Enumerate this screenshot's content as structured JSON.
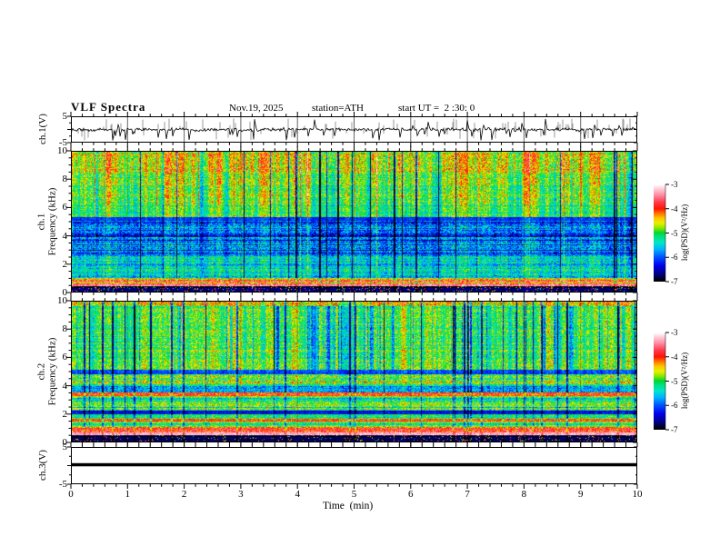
{
  "header": {
    "title": "VLF Spectra",
    "date": "Nov.19, 2025",
    "station": "station=ATH",
    "start_ut": "start UT =  2 :30: 0"
  },
  "panels": {
    "wave1": {
      "ylabel": "ch.1(V)",
      "ytick_labels": [
        "5",
        "-5"
      ],
      "ylim": [
        -5,
        5
      ]
    },
    "spec1": {
      "channel": "ch.1",
      "ylabel": "Frequency (kHz)",
      "ytick_labels": [
        "10",
        "8",
        "6",
        "4",
        "2",
        "0"
      ],
      "ylim": [
        0,
        10
      ]
    },
    "spec2": {
      "channel": "ch.2",
      "ylabel": "Frequency (kHz)",
      "ytick_labels": [
        "10",
        "8",
        "6",
        "4",
        "2",
        "0"
      ],
      "ylim": [
        0,
        10
      ]
    },
    "wave3": {
      "ylabel": "ch.3(V)",
      "ytick_labels": [
        "5",
        "-5"
      ],
      "ylim": [
        -5,
        5
      ]
    }
  },
  "xaxis": {
    "label": "Time  (min)",
    "tick_labels": [
      "0",
      "1",
      "2",
      "3",
      "4",
      "5",
      "6",
      "7",
      "8",
      "9",
      "10"
    ],
    "range": [
      0,
      10
    ],
    "minor_step_min": 0.2
  },
  "colorbars": [
    {
      "label": "log(PSD)(V²/Hz)",
      "tick_labels": [
        "-3",
        "-4",
        "-5",
        "-6",
        "-7"
      ],
      "range": [
        -7,
        -3
      ]
    },
    {
      "label": "log(PSD)(V²/Hz)",
      "tick_labels": [
        "-3",
        "-4",
        "-5",
        "-6",
        "-7"
      ],
      "range": [
        -7,
        -3
      ]
    }
  ],
  "colormap": {
    "stops": [
      [
        0.0,
        "#000000"
      ],
      [
        0.07,
        "#000080"
      ],
      [
        0.16,
        "#0000ee"
      ],
      [
        0.25,
        "#0055ff"
      ],
      [
        0.33,
        "#00b4ff"
      ],
      [
        0.4,
        "#00e8c8"
      ],
      [
        0.47,
        "#00e070"
      ],
      [
        0.5,
        "#00d830"
      ],
      [
        0.55,
        "#8ce800"
      ],
      [
        0.6,
        "#e8f000"
      ],
      [
        0.65,
        "#ffc800"
      ],
      [
        0.7,
        "#ff7800"
      ],
      [
        0.75,
        "#ff1400"
      ],
      [
        0.82,
        "#ff3c50"
      ],
      [
        0.9,
        "#ff96aa"
      ],
      [
        0.96,
        "#ffd2dc"
      ],
      [
        1.0,
        "#ffffff"
      ]
    ]
  },
  "chart_data": [
    {
      "id": "ch1_waveform",
      "type": "line",
      "title": "ch.1 raw amplitude vs time",
      "x_range_min": [
        0,
        10
      ],
      "ylim": [
        -5,
        5
      ],
      "baseline_v": 0,
      "noise_std_v": 0.45,
      "spike_count": 55,
      "spike_amp_range_v": [
        1.2,
        4.5
      ],
      "spike_sign_bias_down": 0.6,
      "gray_envelope_count": 90,
      "gray_envelope_amp_v": [
        1.0,
        4.5
      ],
      "grid": "vertical lines each minute"
    },
    {
      "id": "ch1_spectrogram",
      "type": "heatmap",
      "title": "ch.1 VLF spectrogram",
      "x_range_min": [
        0,
        10
      ],
      "y_range": [
        0,
        10
      ],
      "ylabel": "Frequency (kHz)",
      "z_label": "log(PSD)(V²/Hz)",
      "z_range": [
        -7,
        -3
      ],
      "bands": [
        {
          "f": [
            0,
            0.42
          ],
          "level": -6.85,
          "noise": 0.2,
          "vstreak": 0.1,
          "rowvar": 0.3,
          "speckle": 0.1
        },
        {
          "f": [
            0.42,
            0.6
          ],
          "level": -3.5,
          "noise": 0.35,
          "vstreak": 0.1,
          "rowvar": 0.3
        },
        {
          "f": [
            0.6,
            0.95
          ],
          "level": -4.1,
          "noise": 0.5,
          "vstreak": 0.2,
          "rowvar": 0.5
        },
        {
          "f": [
            0.95,
            1.7
          ],
          "level": -5.25,
          "noise": 0.5,
          "vstreak": 0.45,
          "rowvar": 0.45
        },
        {
          "f": [
            1.7,
            2.65
          ],
          "level": -5.6,
          "noise": 0.5,
          "vstreak": 0.5,
          "rowvar": 0.4
        },
        {
          "f": [
            2.65,
            5.05
          ],
          "level": -6.0,
          "noise": 0.55,
          "vstreak": 0.55,
          "rowvar": 0.5
        },
        {
          "f": [
            5.05,
            5.35
          ],
          "level": -6.2,
          "noise": 0.25,
          "vstreak": 0.35,
          "rowvar": 0.1
        },
        {
          "f": [
            5.35,
            6.2
          ],
          "level": -5.1,
          "noise": 0.4,
          "vstreak": 0.9,
          "rowvar": 0.2
        },
        {
          "f": [
            6.2,
            8.4
          ],
          "level": -4.85,
          "noise": 0.45,
          "vstreak": 1.1,
          "rowvar": 0.2,
          "red_streaks": true
        },
        {
          "f": [
            8.4,
            10.01
          ],
          "level": -4.55,
          "noise": 0.5,
          "vstreak": 1.1,
          "rowvar": 0.25,
          "red_streaks": true
        }
      ],
      "column_effects": {
        "streak_scale": 0.38,
        "dark_col_prob": 0.05,
        "dark_col_delta": -1.7,
        "bright_col_prob": 0.03,
        "bright_col_delta": 0.9
      }
    },
    {
      "id": "ch2_spectrogram",
      "type": "heatmap",
      "title": "ch.2 VLF spectrogram",
      "x_range_min": [
        0,
        10
      ],
      "y_range": [
        0,
        10
      ],
      "ylabel": "Frequency (kHz)",
      "z_label": "log(PSD)(V²/Hz)",
      "z_range": [
        -7,
        -3
      ],
      "bands": [
        {
          "f": [
            0,
            0.45
          ],
          "level": -6.85,
          "noise": 0.2,
          "vstreak": 0.05,
          "rowvar": 0.3,
          "speckle": 0.08
        },
        {
          "f": [
            0.45,
            0.62
          ],
          "level": -3.35,
          "noise": 0.3,
          "vstreak": 0.1,
          "rowvar": 0.2
        },
        {
          "f": [
            0.62,
            1.05
          ],
          "level": -3.9,
          "noise": 0.45,
          "vstreak": 0.15,
          "rowvar": 0.35
        },
        {
          "f": [
            1.05,
            1.42
          ],
          "level": -5.05,
          "noise": 0.45,
          "vstreak": 0.3,
          "rowvar": 0.4
        },
        {
          "f": [
            1.42,
            1.6
          ],
          "level": -4.25,
          "noise": 0.35,
          "vstreak": 0.2,
          "rowvar": 0.2
        },
        {
          "f": [
            1.6,
            1.98
          ],
          "level": -5.0,
          "noise": 0.45,
          "vstreak": 0.35,
          "rowvar": 0.3
        },
        {
          "f": [
            1.98,
            2.2
          ],
          "level": -6.3,
          "noise": 0.3,
          "vstreak": 0.2,
          "rowvar": 0.2
        },
        {
          "f": [
            2.2,
            3.25
          ],
          "level": -5.1,
          "noise": 0.5,
          "vstreak": 0.4,
          "rowvar": 0.45
        },
        {
          "f": [
            3.25,
            3.5
          ],
          "level": -4.1,
          "noise": 0.4,
          "vstreak": 0.2,
          "rowvar": 0.2
        },
        {
          "f": [
            3.5,
            4.1
          ],
          "level": -5.55,
          "noise": 0.5,
          "vstreak": 0.4,
          "rowvar": 0.4
        },
        {
          "f": [
            4.1,
            4.8
          ],
          "level": -4.8,
          "noise": 0.55,
          "vstreak": 0.5,
          "rowvar": 0.35
        },
        {
          "f": [
            4.8,
            5.15
          ],
          "level": -6.1,
          "noise": 0.3,
          "vstreak": 0.4,
          "rowvar": 0.2
        },
        {
          "f": [
            5.15,
            9.7
          ],
          "level": -4.95,
          "noise": 0.45,
          "vstreak": 1.0,
          "rowvar": 0.2,
          "blue_patches": true
        },
        {
          "f": [
            9.7,
            10.01
          ],
          "level": -4.4,
          "noise": 0.6,
          "vstreak": 1.0,
          "rowvar": 0.2
        }
      ],
      "column_effects": {
        "streak_scale": 0.3,
        "dark_col_prob": 0.04,
        "dark_col_delta": -1.5,
        "bright_col_prob": 0.0,
        "bright_col_delta": 0,
        "blue_patch_threshold": -0.22,
        "blue_patch_delta": -0.75
      }
    },
    {
      "id": "ch3_waveform",
      "type": "line",
      "title": "ch.3 raw amplitude vs time (flat)",
      "x_range_min": [
        0,
        10
      ],
      "ylim": [
        -5,
        5
      ],
      "constant_value_v": 0.25,
      "line_thickness_v": 0.9
    }
  ]
}
